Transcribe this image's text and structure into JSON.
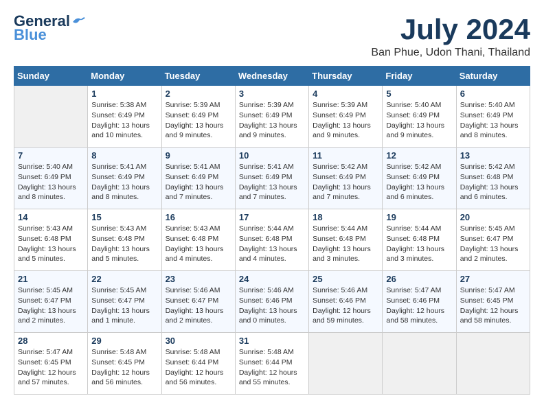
{
  "header": {
    "logo_line1": "General",
    "logo_line2": "Blue",
    "month_year": "July 2024",
    "location": "Ban Phue, Udon Thani, Thailand"
  },
  "days_of_week": [
    "Sunday",
    "Monday",
    "Tuesday",
    "Wednesday",
    "Thursday",
    "Friday",
    "Saturday"
  ],
  "weeks": [
    [
      {
        "day": "",
        "info": ""
      },
      {
        "day": "1",
        "info": "Sunrise: 5:38 AM\nSunset: 6:49 PM\nDaylight: 13 hours\nand 10 minutes."
      },
      {
        "day": "2",
        "info": "Sunrise: 5:39 AM\nSunset: 6:49 PM\nDaylight: 13 hours\nand 9 minutes."
      },
      {
        "day": "3",
        "info": "Sunrise: 5:39 AM\nSunset: 6:49 PM\nDaylight: 13 hours\nand 9 minutes."
      },
      {
        "day": "4",
        "info": "Sunrise: 5:39 AM\nSunset: 6:49 PM\nDaylight: 13 hours\nand 9 minutes."
      },
      {
        "day": "5",
        "info": "Sunrise: 5:40 AM\nSunset: 6:49 PM\nDaylight: 13 hours\nand 9 minutes."
      },
      {
        "day": "6",
        "info": "Sunrise: 5:40 AM\nSunset: 6:49 PM\nDaylight: 13 hours\nand 8 minutes."
      }
    ],
    [
      {
        "day": "7",
        "info": "Sunrise: 5:40 AM\nSunset: 6:49 PM\nDaylight: 13 hours\nand 8 minutes."
      },
      {
        "day": "8",
        "info": "Sunrise: 5:41 AM\nSunset: 6:49 PM\nDaylight: 13 hours\nand 8 minutes."
      },
      {
        "day": "9",
        "info": "Sunrise: 5:41 AM\nSunset: 6:49 PM\nDaylight: 13 hours\nand 7 minutes."
      },
      {
        "day": "10",
        "info": "Sunrise: 5:41 AM\nSunset: 6:49 PM\nDaylight: 13 hours\nand 7 minutes."
      },
      {
        "day": "11",
        "info": "Sunrise: 5:42 AM\nSunset: 6:49 PM\nDaylight: 13 hours\nand 7 minutes."
      },
      {
        "day": "12",
        "info": "Sunrise: 5:42 AM\nSunset: 6:49 PM\nDaylight: 13 hours\nand 6 minutes."
      },
      {
        "day": "13",
        "info": "Sunrise: 5:42 AM\nSunset: 6:48 PM\nDaylight: 13 hours\nand 6 minutes."
      }
    ],
    [
      {
        "day": "14",
        "info": "Sunrise: 5:43 AM\nSunset: 6:48 PM\nDaylight: 13 hours\nand 5 minutes."
      },
      {
        "day": "15",
        "info": "Sunrise: 5:43 AM\nSunset: 6:48 PM\nDaylight: 13 hours\nand 5 minutes."
      },
      {
        "day": "16",
        "info": "Sunrise: 5:43 AM\nSunset: 6:48 PM\nDaylight: 13 hours\nand 4 minutes."
      },
      {
        "day": "17",
        "info": "Sunrise: 5:44 AM\nSunset: 6:48 PM\nDaylight: 13 hours\nand 4 minutes."
      },
      {
        "day": "18",
        "info": "Sunrise: 5:44 AM\nSunset: 6:48 PM\nDaylight: 13 hours\nand 3 minutes."
      },
      {
        "day": "19",
        "info": "Sunrise: 5:44 AM\nSunset: 6:48 PM\nDaylight: 13 hours\nand 3 minutes."
      },
      {
        "day": "20",
        "info": "Sunrise: 5:45 AM\nSunset: 6:47 PM\nDaylight: 13 hours\nand 2 minutes."
      }
    ],
    [
      {
        "day": "21",
        "info": "Sunrise: 5:45 AM\nSunset: 6:47 PM\nDaylight: 13 hours\nand 2 minutes."
      },
      {
        "day": "22",
        "info": "Sunrise: 5:45 AM\nSunset: 6:47 PM\nDaylight: 13 hours\nand 1 minute."
      },
      {
        "day": "23",
        "info": "Sunrise: 5:46 AM\nSunset: 6:47 PM\nDaylight: 13 hours\nand 2 minutes."
      },
      {
        "day": "24",
        "info": "Sunrise: 5:46 AM\nSunset: 6:46 PM\nDaylight: 13 hours\nand 0 minutes."
      },
      {
        "day": "25",
        "info": "Sunrise: 5:46 AM\nSunset: 6:46 PM\nDaylight: 12 hours\nand 59 minutes."
      },
      {
        "day": "26",
        "info": "Sunrise: 5:47 AM\nSunset: 6:46 PM\nDaylight: 12 hours\nand 58 minutes."
      },
      {
        "day": "27",
        "info": "Sunrise: 5:47 AM\nSunset: 6:45 PM\nDaylight: 12 hours\nand 58 minutes."
      }
    ],
    [
      {
        "day": "28",
        "info": "Sunrise: 5:47 AM\nSunset: 6:45 PM\nDaylight: 12 hours\nand 57 minutes."
      },
      {
        "day": "29",
        "info": "Sunrise: 5:48 AM\nSunset: 6:45 PM\nDaylight: 12 hours\nand 56 minutes."
      },
      {
        "day": "30",
        "info": "Sunrise: 5:48 AM\nSunset: 6:44 PM\nDaylight: 12 hours\nand 56 minutes."
      },
      {
        "day": "31",
        "info": "Sunrise: 5:48 AM\nSunset: 6:44 PM\nDaylight: 12 hours\nand 55 minutes."
      },
      {
        "day": "",
        "info": ""
      },
      {
        "day": "",
        "info": ""
      },
      {
        "day": "",
        "info": ""
      }
    ]
  ]
}
